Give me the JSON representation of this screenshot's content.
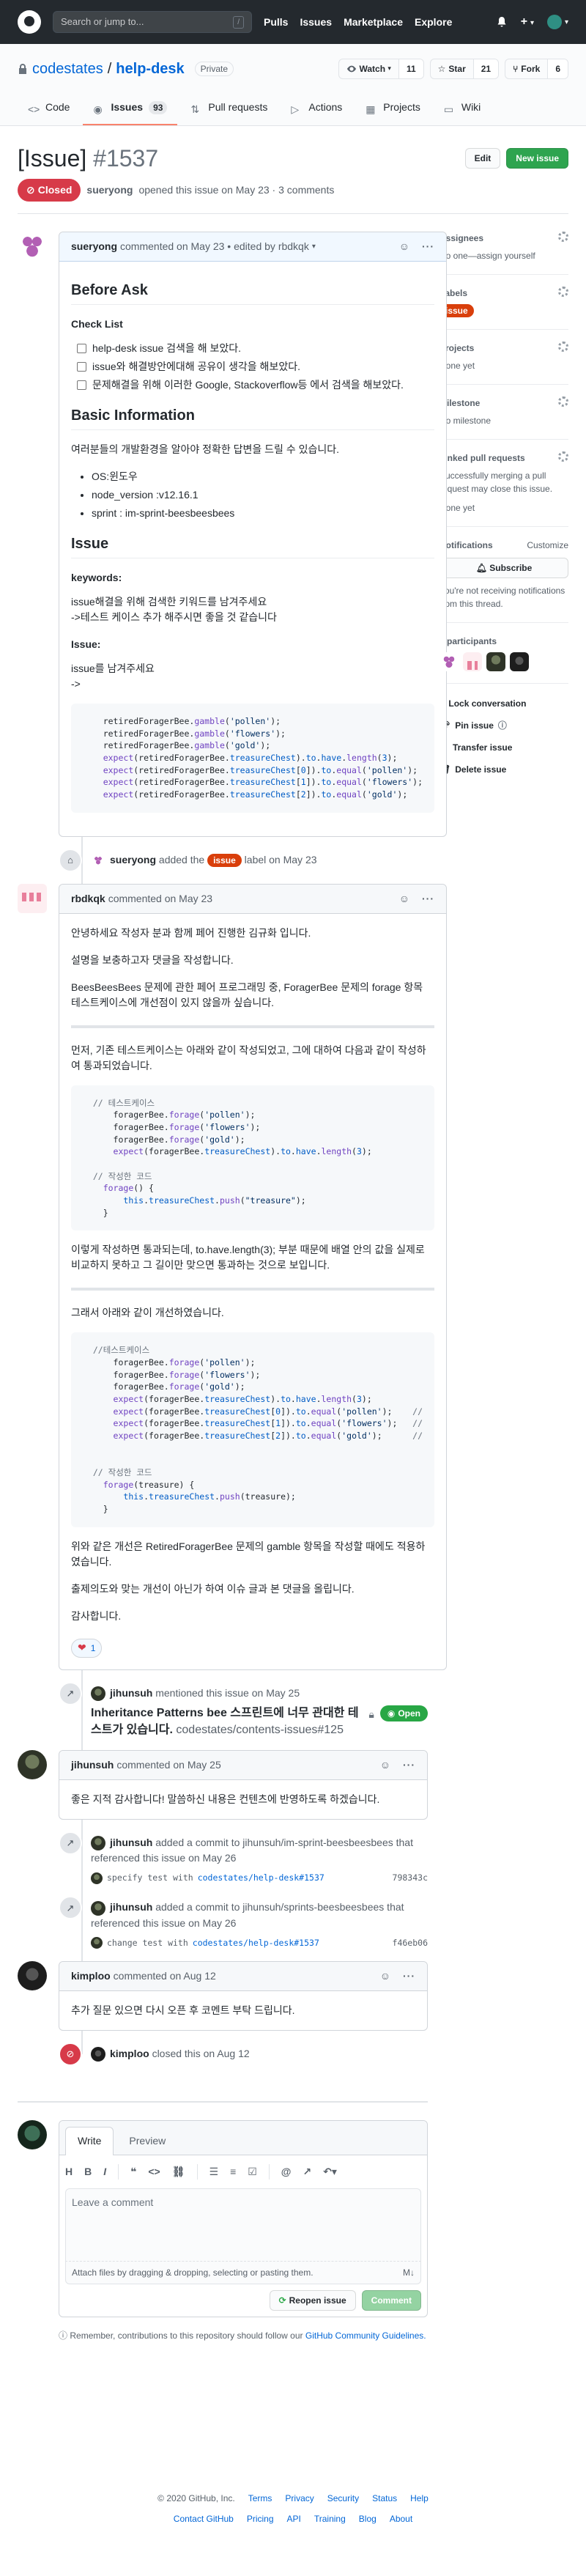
{
  "header": {
    "search_placeholder": "Search or jump to...",
    "search_shortcut": "/",
    "nav": [
      "Pulls",
      "Issues",
      "Marketplace",
      "Explore"
    ],
    "bell_icon": "bell-icon",
    "plus_label": "+",
    "caret": "▾"
  },
  "repo": {
    "owner": "codestates",
    "separator": "/",
    "name": "help-desk",
    "visibility": "Private",
    "watch_label": "Watch",
    "watch_count": "11",
    "star_label": "Star",
    "star_count": "21",
    "fork_label": "Fork",
    "fork_count": "6",
    "tabs": [
      {
        "label": "Code",
        "icon": "code-icon"
      },
      {
        "label": "Issues",
        "count": "93",
        "icon": "issue-opened-icon"
      },
      {
        "label": "Pull requests",
        "icon": "pull-request-icon"
      },
      {
        "label": "Actions",
        "icon": "play-icon"
      },
      {
        "label": "Projects",
        "icon": "project-icon"
      },
      {
        "label": "Wiki",
        "icon": "book-icon"
      }
    ]
  },
  "issue": {
    "title": "[Issue]",
    "number": "#1537",
    "edit_label": "Edit",
    "new_issue_label": "New issue",
    "state": "Closed",
    "author": "sueryong",
    "meta_text": "opened this issue on May 23 · 3 comments"
  },
  "first_comment": {
    "author": "sueryong",
    "meta": "commented on May 23 • edited by rbdkqk",
    "caret": "▾",
    "h_before": "Before Ask",
    "h_checklist": "Check List",
    "checklist": [
      "help-desk issue 검색을 해 보았다.",
      "issue와 해결방안에대해 공유이 생각을 해보았다.",
      "문제해결을 위해 이러한 Google, Stackoverflow등 에서 검색을 해보았다."
    ],
    "h_basic": "Basic Information",
    "basic_desc": "여러분들의 개발환경을 알아야 정확한 답변을 드릴 수 있습니다.",
    "basic_items": [
      "OS:윈도우",
      "node_version :v12.16.1",
      "sprint : im-sprint-beesbeesbees"
    ],
    "h_issue": "Issue",
    "kw_label": "keywords:",
    "kw_text_1": "issue해결을 위해 검색한 키워드를 남겨주세요",
    "kw_text_2": "->테스트 케이스 추가 해주시면 좋을 것 같습니다",
    "issue_label": "Issue:",
    "issue_text_1": "issue를 남겨주세요",
    "issue_text_2": "->"
  },
  "label_event": {
    "author": "sueryong",
    "text_before": "added the",
    "label": "issue",
    "text_after": "label on May 23"
  },
  "second_comment": {
    "author": "rbdkqk",
    "meta": "commented on May 23",
    "p1": "안녕하세요 작성자 분과 함께 페어 진행한 김규화 입니다.",
    "p2": "설명을 보충하고자 댓글을 작성합니다.",
    "p3": "BeesBeesBees 문제에 관한 페어 프로그래밍 중, ForagerBee 문제의 forage 항목 테스트케이스에 개선점이 있지 않을까 싶습니다.",
    "p4": "먼저, 기존 테스트케이스는 아래와 같이 작성되었고, 그에 대하여 다음과 같이 작성하여 통과되었습니다.",
    "p5": "이렇게 작성하면 통과되는데, to.have.length(3); 부분 때문에 배열 안의 값을 실제로 비교하지 못하고 그 길이만 맞으면 통과하는 것으로 보입니다.",
    "p6": "그래서 아래와 같이 개선하였습니다.",
    "p7": "위와 같은 개선은 RetiredForagerBee 문제의 gamble 항목을 작성할 때에도 적용하였습니다.",
    "p8": "출제의도와 맞는 개선이 아닌가 하여 이슈 글과 본 댓글을 올립니다.",
    "p9": "감사합니다.",
    "reaction_count": "1"
  },
  "mention_event": {
    "author": "jihunsuh",
    "text": "mentioned this issue on May 25",
    "title": "Inheritance Patterns bee 스프린트에 너무 관대한 테스트가 있습니다.",
    "ref": "codestates/contents-issues#125",
    "state": "Open"
  },
  "third_comment": {
    "author": "jihunsuh",
    "meta": "commented on May 25",
    "body": "좋은 지적 감사합니다! 말씀하신 내용은 컨텐츠에 반영하도록 하겠습니다."
  },
  "commit_events": [
    {
      "author": "jihunsuh",
      "text": "added a commit to jihunsuh/im-sprint-beesbeesbees that referenced this issue on May 26",
      "message": "specify test with",
      "ref": "codestates/help-desk#1537",
      "sha": "798343c"
    },
    {
      "author": "jihunsuh",
      "text": "added a commit to jihunsuh/sprints-beesbeesbees that referenced this issue on May 26",
      "message": "change test with",
      "ref": "codestates/help-desk#1537",
      "sha": "f46eb06"
    }
  ],
  "fourth_comment": {
    "author": "kimploo",
    "meta": "commented on Aug 12",
    "body": "추가 질문 있으면 다시 오픈 후 코멘트 부탁 드립니다."
  },
  "close_event": {
    "author": "kimploo",
    "text": "closed this on Aug 12"
  },
  "composer": {
    "tab_write": "Write",
    "tab_preview": "Preview",
    "placeholder": "Leave a comment",
    "attach_text": "Attach files by dragging & dropping, selecting or pasting them.",
    "reopen_label": "Reopen issue",
    "comment_label": "Comment",
    "remember_text": "Remember, contributions to this repository should follow our",
    "remember_link": "GitHub Community Guidelines."
  },
  "sidebar": {
    "assignees_title": "Assignees",
    "assignees_value": "No one—assign yourself",
    "labels_title": "Labels",
    "labels_value": "issue",
    "projects_title": "Projects",
    "projects_value": "None yet",
    "milestone_title": "Milestone",
    "milestone_value": "No milestone",
    "linked_title": "Linked pull requests",
    "linked_desc": "Successfully merging a pull request may close this issue.",
    "linked_value": "None yet",
    "notif_title": "Notifications",
    "notif_customize": "Customize",
    "subscribe_label": "Subscribe",
    "notif_desc": "You're not receiving notifications from this thread.",
    "participants": "4 participants",
    "actions": [
      "Lock conversation",
      "Pin issue",
      "Transfer issue",
      "Delete issue"
    ]
  },
  "footer": {
    "copyright": "© 2020 GitHub, Inc.",
    "row1": [
      "Terms",
      "Privacy",
      "Security",
      "Status",
      "Help"
    ],
    "row2": [
      "Contact GitHub",
      "Pricing",
      "API",
      "Training",
      "Blog",
      "About"
    ]
  }
}
